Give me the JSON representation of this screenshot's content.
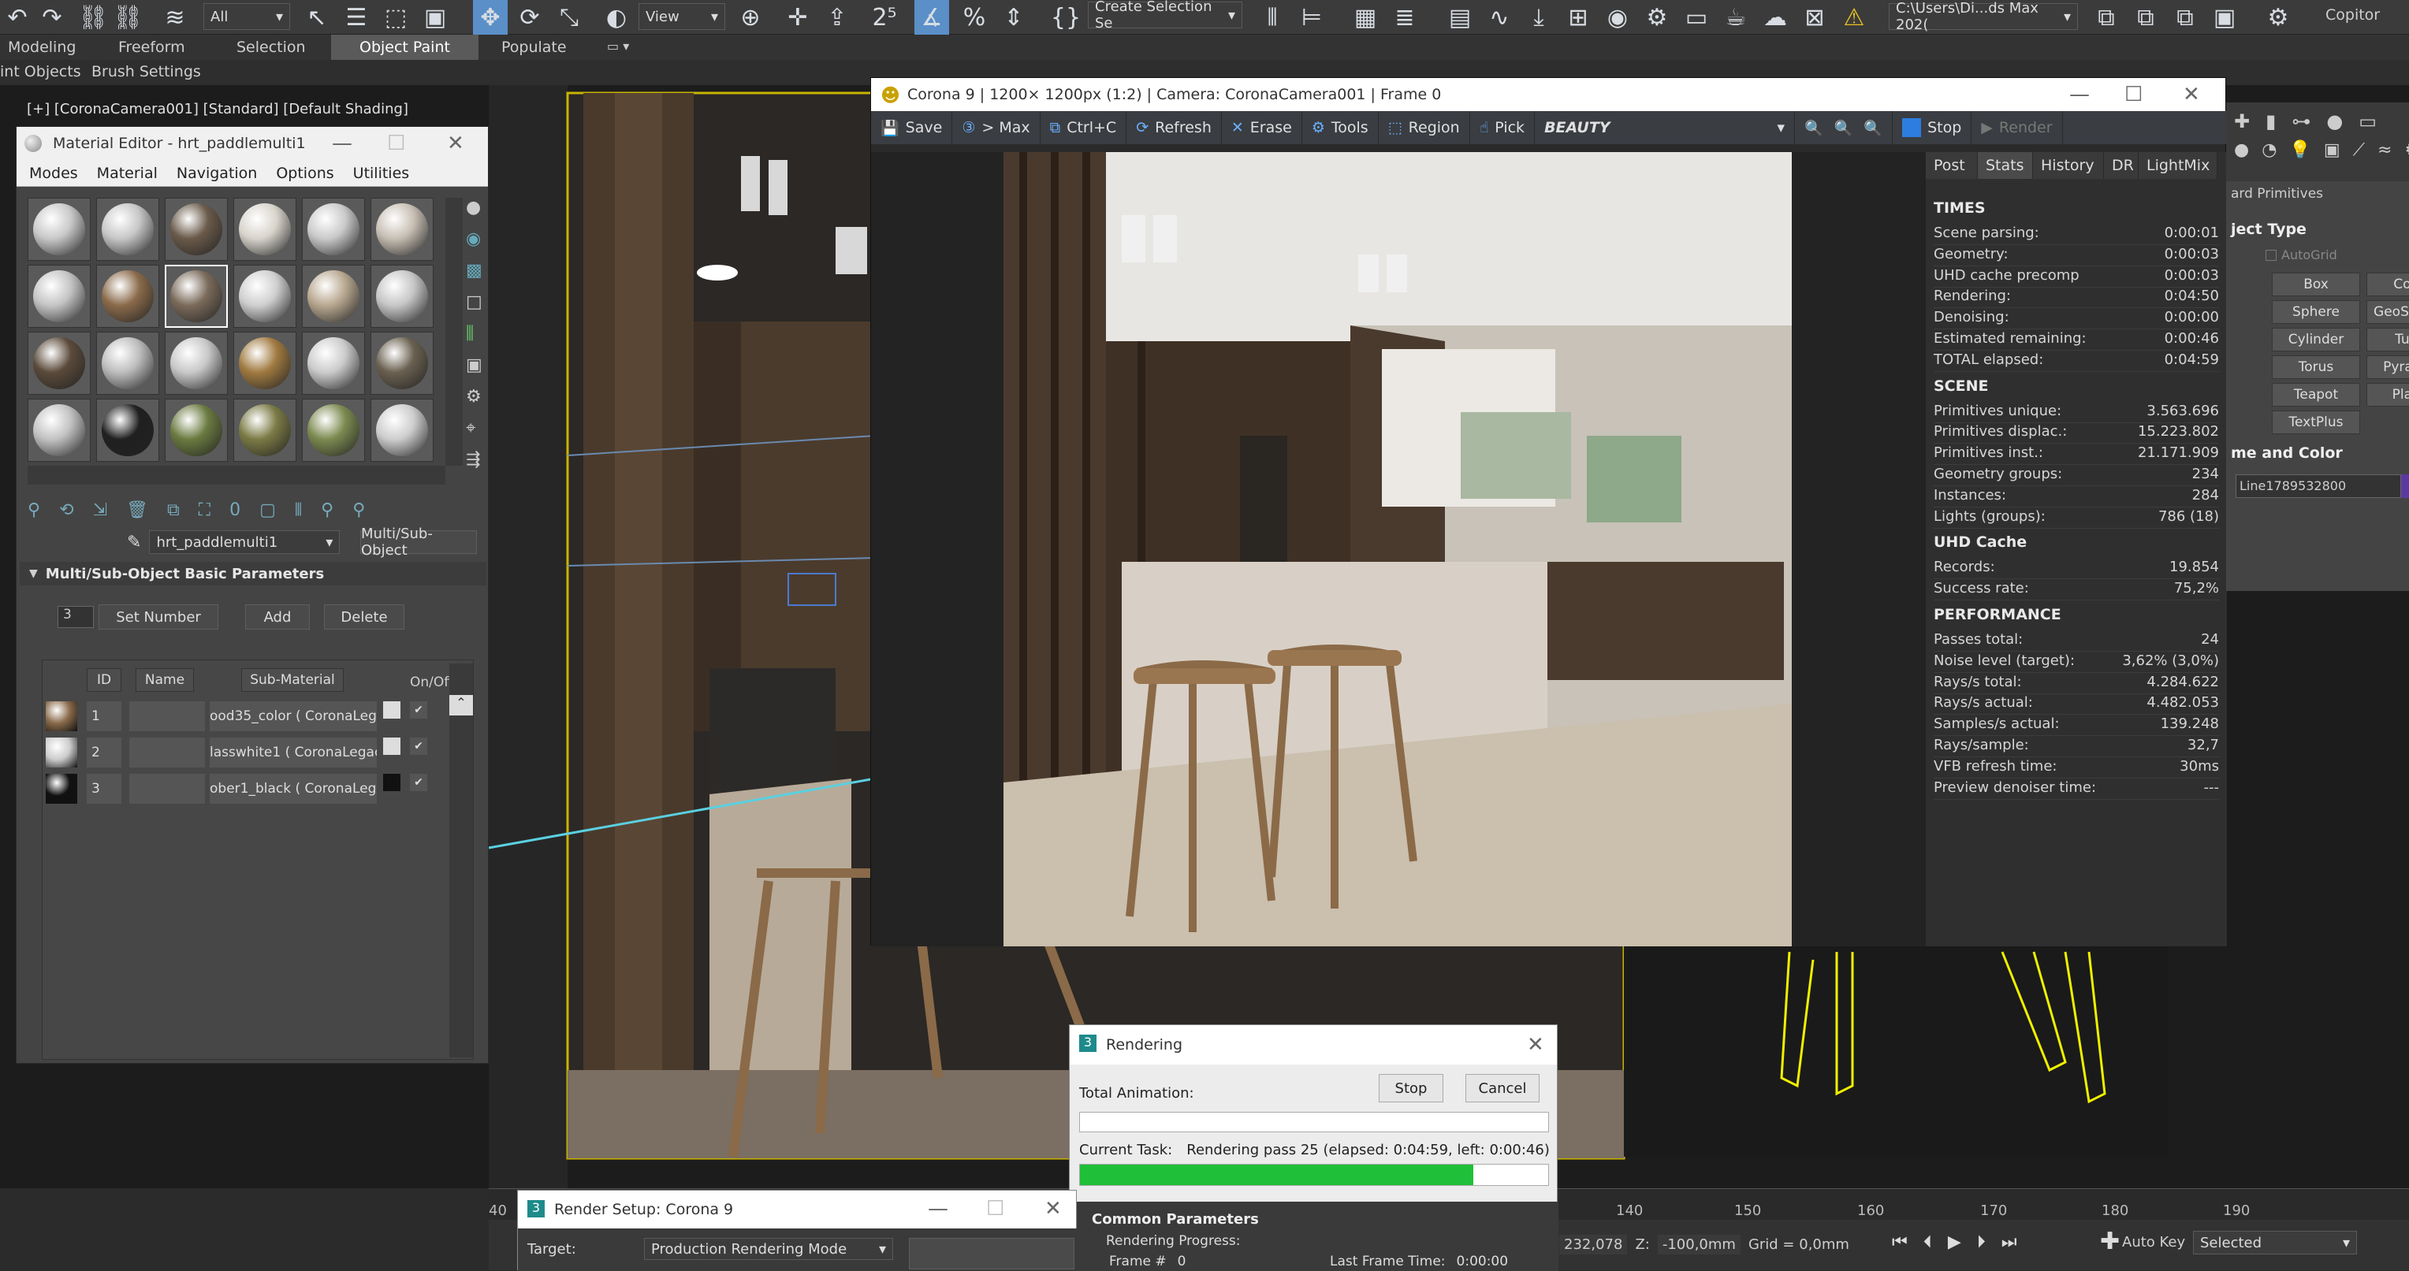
{
  "toolbar": {
    "selection_filter": "All",
    "view_dropdown": "View",
    "named_selection": "Create Selection Se",
    "project_path": "C:\\Users\\Di...ds Max 202(",
    "copilot": "Copitor"
  },
  "ribbon": {
    "tabs": [
      "Modeling",
      "Freeform",
      "Selection",
      "Object Paint",
      "Populate"
    ],
    "active_tab": "Object Paint",
    "sub_items": [
      "int Objects",
      "Brush Settings"
    ]
  },
  "viewport": {
    "label": "[+] [CoronaCamera001] [Standard] [Default Shading]"
  },
  "material_editor": {
    "title": "Material Editor - hrt_paddlemulti1",
    "menu": [
      "Modes",
      "Material",
      "Navigation",
      "Options",
      "Utilities"
    ],
    "material_name": "hrt_paddlemulti1",
    "material_type": "Multi/Sub-Object",
    "rollout_title": "Multi/Sub-Object Basic Parameters",
    "set_number_value": "3",
    "set_number_label": "Set Number",
    "add_label": "Add",
    "delete_label": "Delete",
    "columns": [
      "ID",
      "Name",
      "Sub-Material",
      "On/Off"
    ],
    "rows": [
      {
        "id": "1",
        "submat": "ood35_color  ( CoronaLegac"
      },
      {
        "id": "2",
        "submat": "lasswhite1  ( CoronaLegac"
      },
      {
        "id": "3",
        "submat": "ober1_black  ( CoronaLega"
      }
    ],
    "slot_colors": [
      "#c9c9c9",
      "#c7c7c7",
      "#6a5a4a",
      "#d8d4cc",
      "#cacaca",
      "#c8bfb4",
      "#c4c4c4",
      "#8a6a4a",
      "#7a6a5a",
      "#cfcfcf",
      "#b8a890",
      "#c6c6c6",
      "#5a4a3a",
      "#bdbdbd",
      "#c8c8c8",
      "#a07a40",
      "#cbcbcb",
      "#6a6050",
      "#c2c2c2",
      "#202020",
      "#6a7a40",
      "#7a7a45",
      "#7c8a50",
      "#cdcdcd"
    ]
  },
  "vfb": {
    "title": "Corona 9 | 1200× 1200px (1:2) | Camera: CoronaCamera001 | Frame 0",
    "toolbar": [
      "Save",
      "> Max",
      "Ctrl+C",
      "Refresh",
      "Erase",
      "Tools",
      "Region",
      "Pick"
    ],
    "channel": "BEAUTY",
    "stop": "Stop",
    "render": "Render",
    "stat_tabs": [
      "Post",
      "Stats",
      "History",
      "DR",
      "LightMix"
    ],
    "active_stat_tab": "Stats",
    "sections": [
      {
        "title": "TIMES",
        "rows": [
          [
            "Scene parsing:",
            "0:00:01"
          ],
          [
            "Geometry:",
            "0:00:03"
          ],
          [
            "UHD cache precomp",
            "0:00:03"
          ],
          [
            "Rendering:",
            "0:04:50"
          ],
          [
            "Denoising:",
            "0:00:00"
          ],
          [
            "Estimated remaining:",
            "0:00:46"
          ],
          [
            "TOTAL elapsed:",
            "0:04:59"
          ]
        ]
      },
      {
        "title": "SCENE",
        "rows": [
          [
            "Primitives unique:",
            "3.563.696"
          ],
          [
            "Primitives displac.:",
            "15.223.802"
          ],
          [
            "Primitives inst.:",
            "21.171.909"
          ],
          [
            "Geometry groups:",
            "234"
          ],
          [
            "Instances:",
            "284"
          ],
          [
            "Lights (groups):",
            "786 (18)"
          ]
        ]
      },
      {
        "title": "UHD Cache",
        "rows": [
          [
            "Records:",
            "19.854"
          ],
          [
            "Success rate:",
            "75,2%"
          ]
        ]
      },
      {
        "title": "PERFORMANCE",
        "rows": [
          [
            "Passes total:",
            "24"
          ],
          [
            "Noise level (target):",
            "3,62% (3,0%)"
          ],
          [
            "Rays/s total:",
            "4.284.622"
          ],
          [
            "Rays/s actual:",
            "4.482.053"
          ],
          [
            "Samples/s actual:",
            "139.248"
          ],
          [
            "Rays/sample:",
            "32,7"
          ],
          [
            "VFB refresh time:",
            "30ms"
          ],
          [
            "Preview denoiser time:",
            "---"
          ]
        ]
      }
    ]
  },
  "command_panel": {
    "header": "ard Primitives",
    "object_type": "ject Type",
    "autogrid": "AutoGrid",
    "buttons": [
      "Box",
      "Cone",
      "Sphere",
      "GeoSphere",
      "Cylinder",
      "Tube",
      "Torus",
      "Pyramid",
      "Teapot",
      "Plane",
      "TextPlus"
    ],
    "name_color": "me and Color",
    "object_name": "Line1789532800"
  },
  "rendering_dialog": {
    "title": "Rendering",
    "total_animation": "Total Animation:",
    "stop": "Stop",
    "cancel": "Cancel",
    "current_task_label": "Current Task:",
    "current_task": "Rendering pass 25 (elapsed: 0:04:59, left: 0:00:46)",
    "progress": 0.84,
    "common_params": "Common Parameters",
    "render_progress": "Rendering Progress:",
    "frame_label": "Frame #",
    "frame_value": "0",
    "last_frame_label": "Last Frame Time:",
    "last_frame_value": "0:00:00"
  },
  "render_setup": {
    "title": "Render Setup: Corona 9",
    "target_label": "Target:",
    "target_value": "Production Rendering Mode"
  },
  "status": {
    "timeline_ticks": [
      "40",
      "140",
      "150",
      "160",
      "170",
      "180",
      "190"
    ],
    "coord_y": "232,078",
    "coord_z_label": "Z:",
    "coord_z": "-100,0mm",
    "grid": "Grid = 0,0mm",
    "auto_key": "Auto Key",
    "selected": "Selected"
  }
}
